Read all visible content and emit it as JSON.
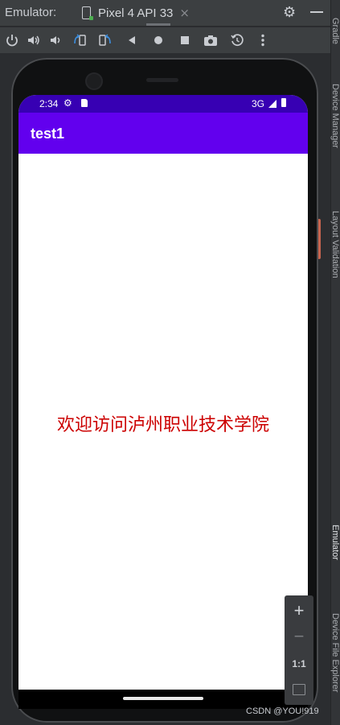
{
  "window": {
    "label": "Emulator:",
    "device_tab": "Pixel 4 API 33",
    "tab_close": "×"
  },
  "toolbar": {
    "icons": [
      "power-icon",
      "volume-up-icon",
      "volume-down-icon",
      "rotate-left-icon",
      "rotate-right-icon",
      "back-icon",
      "home-icon",
      "overview-icon",
      "screenshot-icon",
      "snapshot-icon",
      "more-icon"
    ]
  },
  "side_panel": {
    "labels": [
      "Gradle",
      "Device Manager",
      "Layout Validation",
      "Emulator",
      "Device File Explorer"
    ]
  },
  "phone": {
    "status": {
      "time": "2:34",
      "network": "3G"
    },
    "app_title": "test1",
    "content_text": "欢迎访问泸州职业技术学院"
  },
  "zoom": {
    "plus": "+",
    "minus": "−",
    "one_to_one": "1:1"
  },
  "watermark": "CSDN @YOU!919",
  "colors": {
    "status_bar": "#3700b3",
    "app_bar": "#6200ee",
    "content_text": "#cc0000"
  }
}
